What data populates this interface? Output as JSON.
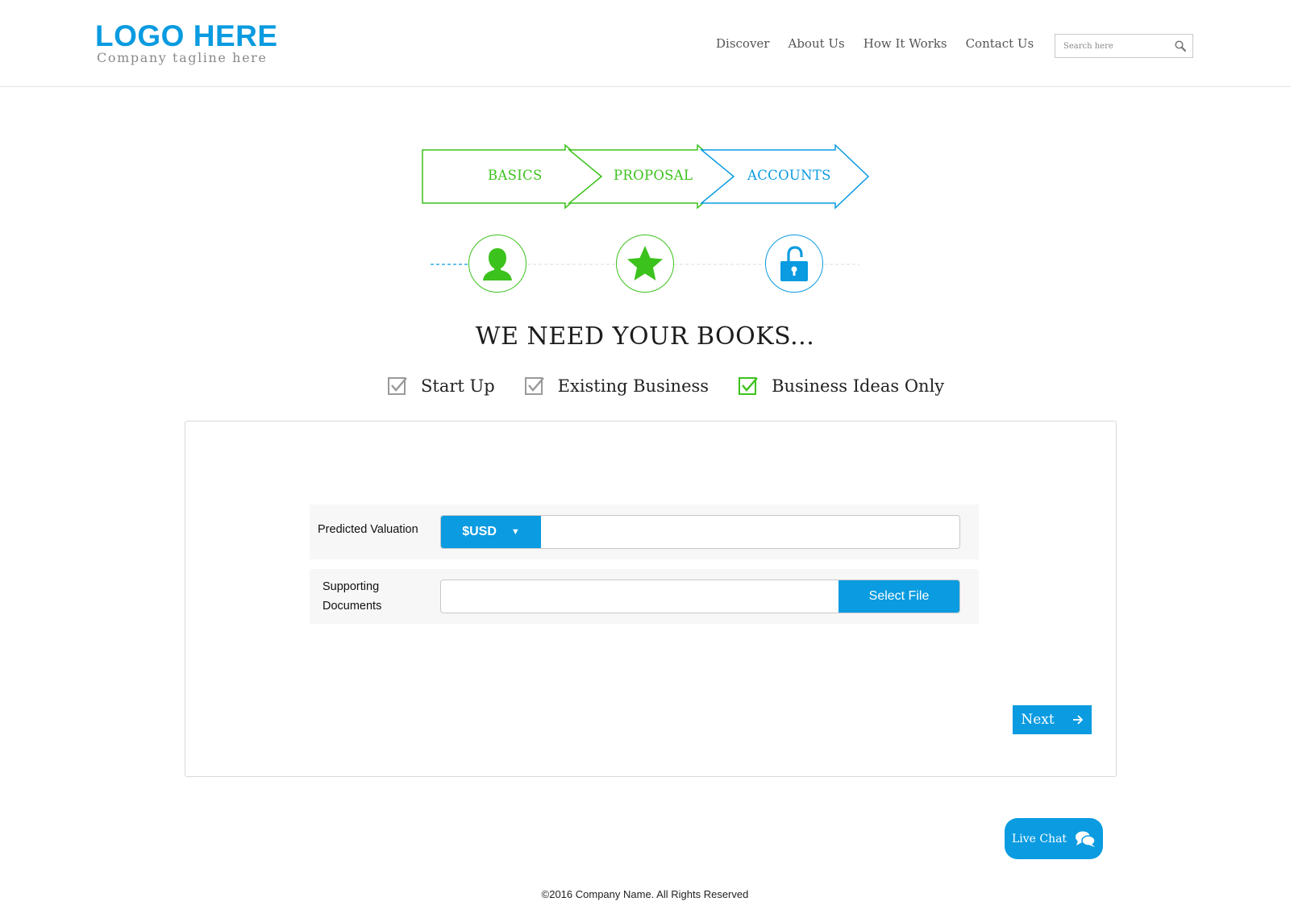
{
  "header": {
    "logo_title": "LOGO HERE",
    "logo_tagline": "Company tagline here",
    "nav": [
      "Discover",
      "About Us",
      "How It Works",
      "Contact Us"
    ],
    "search_placeholder": "Search here"
  },
  "steps": [
    {
      "label": "BASICS",
      "state": "done",
      "color": "#3cc21c",
      "icon": "user-icon"
    },
    {
      "label": "PROPOSAL",
      "state": "done",
      "color": "#3cc21c",
      "icon": "star-icon"
    },
    {
      "label": "ACCOUNTS",
      "state": "current",
      "color": "#0a9be0",
      "icon": "unlock-icon"
    }
  ],
  "headline": "WE NEED YOUR BOOKS...",
  "business_types": [
    {
      "label": "Start Up",
      "checked": false
    },
    {
      "label": "Existing Business",
      "checked": false
    },
    {
      "label": "Business Ideas Only",
      "checked": true
    }
  ],
  "form": {
    "valuation_label": "Predicted Valuation",
    "currency": "$USD",
    "valuation_value": "",
    "documents_label": "Supporting Documents",
    "documents_value": "",
    "select_file_label": "Select File",
    "next_label": "Next"
  },
  "live_chat_label": "Live Chat",
  "footer": "©2016 Company Name. All Rights Reserved",
  "colors": {
    "brand_blue": "#0a9be0",
    "success_green": "#3cc21c",
    "checkbox_gray": "#9a9a9a"
  }
}
